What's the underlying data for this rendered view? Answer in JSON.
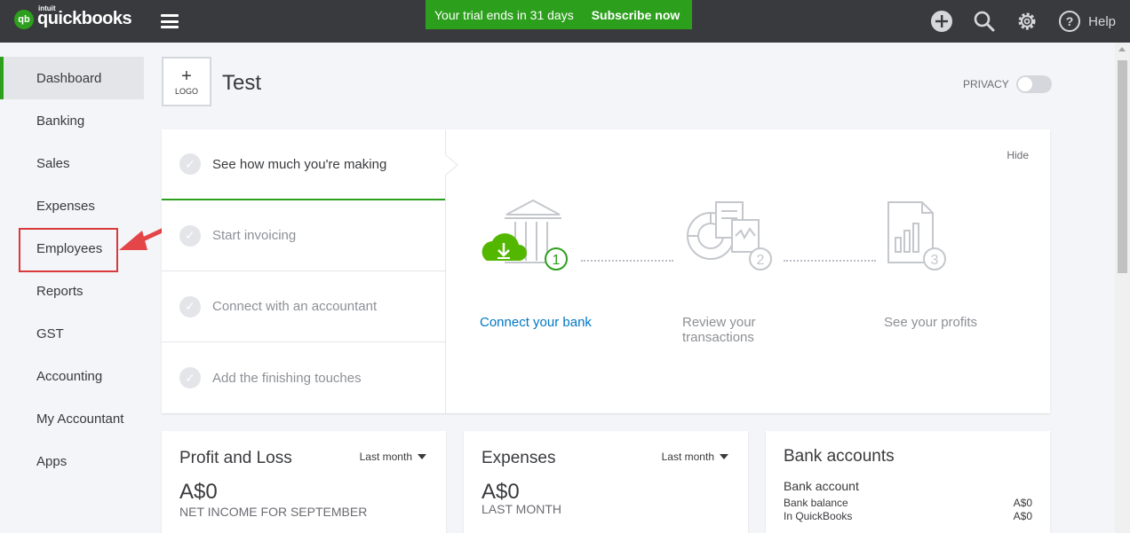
{
  "header": {
    "logo_badge": "qb",
    "logo_small": "intuit",
    "logo_name": "quickbooks",
    "trial_text": "Your trial ends in 31 days",
    "subscribe_label": "Subscribe now",
    "help_label": "Help"
  },
  "sidebar": {
    "items": [
      {
        "label": "Dashboard"
      },
      {
        "label": "Banking"
      },
      {
        "label": "Sales"
      },
      {
        "label": "Expenses"
      },
      {
        "label": "Employees"
      },
      {
        "label": "Reports"
      },
      {
        "label": "GST"
      },
      {
        "label": "Accounting"
      },
      {
        "label": "My Accountant"
      },
      {
        "label": "Apps"
      }
    ]
  },
  "company": {
    "logo_plus": "+",
    "logo_label": "LOGO",
    "name": "Test",
    "privacy_label": "PRIVACY"
  },
  "setup": {
    "hide_label": "Hide",
    "steps": [
      {
        "label": "See how much you're making"
      },
      {
        "label": "Start invoicing"
      },
      {
        "label": "Connect with an accountant"
      },
      {
        "label": "Add the finishing touches"
      }
    ],
    "flow": [
      {
        "number": "1",
        "label": "Connect your bank"
      },
      {
        "number": "2",
        "label_line1": "Review your",
        "label_line2": "transactions"
      },
      {
        "number": "3",
        "label": "See your profits"
      }
    ]
  },
  "cards": {
    "profit_loss": {
      "title": "Profit and Loss",
      "period": "Last month",
      "amount": "A$0",
      "subtitle": "NET INCOME FOR SEPTEMBER"
    },
    "expenses": {
      "title": "Expenses",
      "period": "Last month",
      "amount": "A$0",
      "subtitle": "LAST MONTH"
    },
    "bank_accounts": {
      "title": "Bank accounts",
      "account_name": "Bank account",
      "rows": [
        {
          "label": "Bank balance",
          "value": "A$0"
        },
        {
          "label": "In QuickBooks",
          "value": "A$0"
        }
      ]
    }
  },
  "colors": {
    "brand_green": "#2ca01c",
    "topbar": "#393a3d",
    "link_blue": "#0077c5",
    "annotation_red": "#d9393b"
  }
}
